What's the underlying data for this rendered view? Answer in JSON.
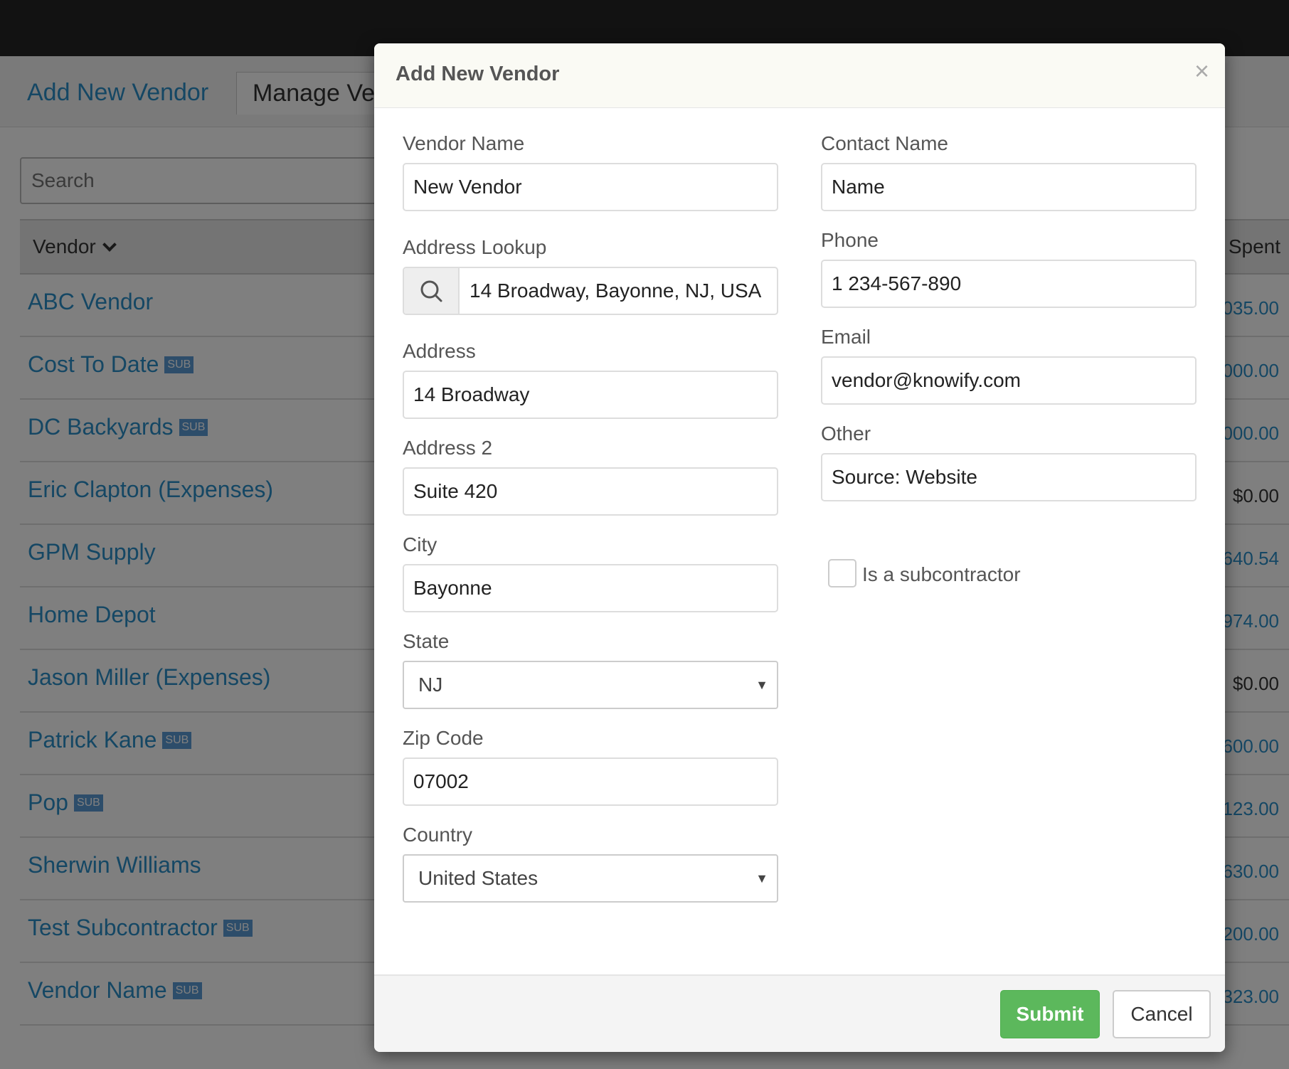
{
  "background": {
    "tabs": {
      "add_new_vendor": "Add New Vendor",
      "manage_vendors": "Manage Ve"
    },
    "search": {
      "placeholder": "Search"
    },
    "table": {
      "vendor_header": "Vendor",
      "spent_header": "Spent",
      "rows": [
        {
          "name": "ABC Vendor",
          "sub": "",
          "spent": "035.00"
        },
        {
          "name": "Cost To Date",
          "sub": "SUB",
          "spent": "000.00"
        },
        {
          "name": "DC Backyards",
          "sub": "SUB",
          "spent": "000.00"
        },
        {
          "name": "Eric Clapton (Expenses)",
          "sub": "",
          "spent": "$0.00"
        },
        {
          "name": "GPM Supply",
          "sub": "",
          "spent": "640.54"
        },
        {
          "name": "Home Depot",
          "sub": "",
          "spent": "974.00"
        },
        {
          "name": "Jason Miller (Expenses)",
          "sub": "",
          "spent": "$0.00"
        },
        {
          "name": "Patrick Kane",
          "sub": "SUB",
          "spent": "600.00"
        },
        {
          "name": "Pop",
          "sub": "SUB",
          "spent": "123.00"
        },
        {
          "name": "Sherwin Williams",
          "sub": "",
          "spent": "630.00"
        },
        {
          "name": "Test Subcontractor",
          "sub": "SUB",
          "spent": "200.00"
        },
        {
          "name": "Vendor Name",
          "sub": "SUB",
          "spent": "323.00"
        }
      ]
    }
  },
  "modal": {
    "title": "Add New Vendor",
    "close_label": "×",
    "left_fields": {
      "vendor_name": {
        "label": "Vendor Name",
        "value": "New Vendor"
      },
      "address_lookup": {
        "label": "Address Lookup",
        "value": "14 Broadway, Bayonne, NJ, USA"
      },
      "address": {
        "label": "Address",
        "value": "14 Broadway"
      },
      "address2": {
        "label": "Address 2",
        "value": "Suite 420"
      },
      "city": {
        "label": "City",
        "value": "Bayonne"
      },
      "state": {
        "label": "State",
        "value": "NJ"
      },
      "zip": {
        "label": "Zip Code",
        "value": "07002"
      },
      "country": {
        "label": "Country",
        "value": "United States"
      }
    },
    "right_fields": {
      "contact_name": {
        "label": "Contact Name",
        "value": "Name"
      },
      "phone": {
        "label": "Phone",
        "value": "1 234-567-890"
      },
      "email": {
        "label": "Email",
        "value": "vendor@knowify.com"
      },
      "other": {
        "label": "Other",
        "value": "Source: Website"
      }
    },
    "subcontractor": {
      "label": "Is a subcontractor",
      "checked": false
    },
    "footer": {
      "submit_label": "Submit",
      "cancel_label": "Cancel"
    }
  },
  "icons": {
    "lookup": "search-icon",
    "select_caret": "caret-down-icon",
    "sort": "chevron-down-icon",
    "close": "close-icon"
  },
  "colors": {
    "link": "#2a8fc8",
    "submit": "#5cb85c",
    "topbar": "#252525",
    "modal_header": "#fafaf4"
  }
}
